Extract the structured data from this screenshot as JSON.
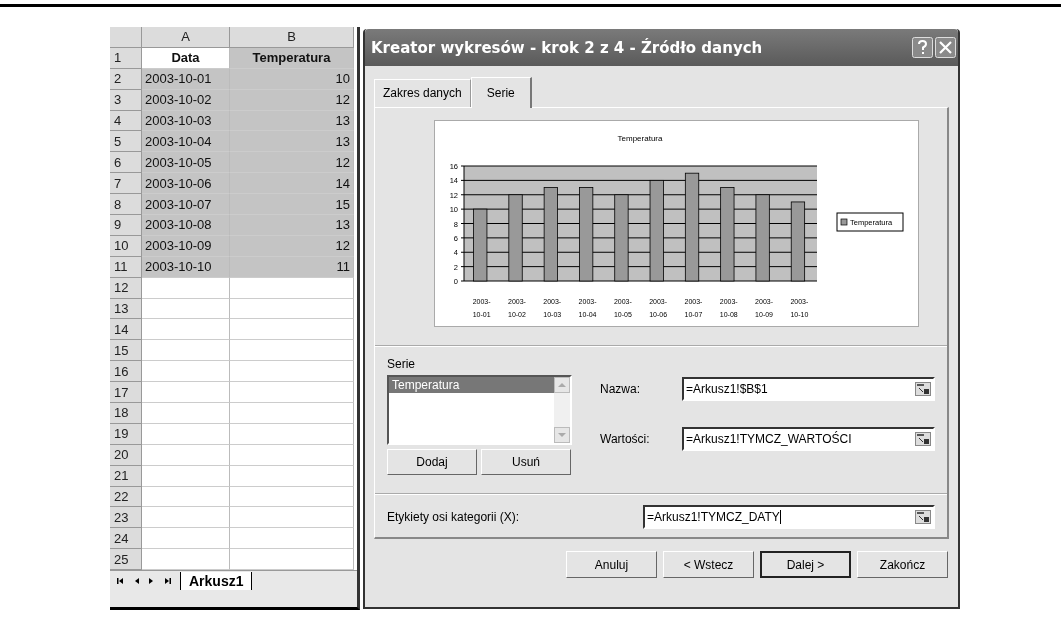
{
  "sheet": {
    "columns": [
      "A",
      "B"
    ],
    "rows": [
      {
        "number": "1",
        "kind": "header",
        "selected": true,
        "cells": [
          "Data",
          "Temperatura"
        ]
      },
      {
        "number": "2",
        "kind": "data",
        "selected": true,
        "cells": [
          "2003-10-01",
          "10"
        ]
      },
      {
        "number": "3",
        "kind": "data",
        "selected": true,
        "cells": [
          "2003-10-02",
          "12"
        ]
      },
      {
        "number": "4",
        "kind": "data",
        "selected": true,
        "cells": [
          "2003-10-03",
          "13"
        ]
      },
      {
        "number": "5",
        "kind": "data",
        "selected": true,
        "cells": [
          "2003-10-04",
          "13"
        ]
      },
      {
        "number": "6",
        "kind": "data",
        "selected": true,
        "cells": [
          "2003-10-05",
          "12"
        ]
      },
      {
        "number": "7",
        "kind": "data",
        "selected": true,
        "cells": [
          "2003-10-06",
          "14"
        ]
      },
      {
        "number": "8",
        "kind": "data",
        "selected": true,
        "cells": [
          "2003-10-07",
          "15"
        ]
      },
      {
        "number": "9",
        "kind": "data",
        "selected": true,
        "cells": [
          "2003-10-08",
          "13"
        ]
      },
      {
        "number": "10",
        "kind": "data",
        "selected": true,
        "cells": [
          "2003-10-09",
          "12"
        ]
      },
      {
        "number": "11",
        "kind": "data",
        "selected": true,
        "cells": [
          "2003-10-10",
          "11"
        ]
      },
      {
        "number": "12"
      },
      {
        "number": "13"
      },
      {
        "number": "14"
      },
      {
        "number": "15"
      },
      {
        "number": "16"
      },
      {
        "number": "17"
      },
      {
        "number": "18"
      },
      {
        "number": "19"
      },
      {
        "number": "20"
      },
      {
        "number": "21"
      },
      {
        "number": "22"
      },
      {
        "number": "23"
      },
      {
        "number": "24"
      },
      {
        "number": "25"
      }
    ],
    "tabs": [
      {
        "label": "Arkusz1",
        "selected": true
      }
    ]
  },
  "dialog": {
    "title": "Kreator wykresów - krok 2 z 4 - Źródło danych",
    "tabs": [
      {
        "label": "Zakres danych",
        "selected": false
      },
      {
        "label": "Serie",
        "selected": true
      }
    ],
    "chart_data": {
      "type": "bar",
      "title": "Temperatura",
      "categories": [
        "2003-10-01",
        "2003-10-02",
        "2003-10-03",
        "2003-10-04",
        "2003-10-05",
        "2003-10-06",
        "2003-10-07",
        "2003-10-08",
        "2003-10-09",
        "2003-10-10"
      ],
      "series": [
        {
          "name": "Temperatura",
          "color": "#999999",
          "values": [
            10,
            12,
            13,
            13,
            12,
            14,
            15,
            13,
            12,
            11
          ]
        }
      ],
      "ylim": [
        0,
        16
      ],
      "grid": true,
      "yticks": [
        0,
        2,
        4,
        6,
        8,
        10,
        12,
        14,
        16
      ]
    },
    "series_label": "Serie",
    "series_list": [
      {
        "label": "Temperatura",
        "selected": true
      }
    ],
    "add_button": "Dodaj",
    "remove_button": "Usuń",
    "fields": [
      {
        "label": "Nazwa:",
        "value": "=Arkusz1!$B$1"
      },
      {
        "label": "Wartości:",
        "value": "=Arkusz1!TYMCZ_WARTOŚCI"
      }
    ],
    "category_field": {
      "label": "Etykiety osi kategorii (X):",
      "value": "=Arkusz1!TYMCZ_DATY"
    },
    "buttons": [
      {
        "label": "Anuluj",
        "default": false
      },
      {
        "label": "< Wstecz",
        "default": false
      },
      {
        "label": "Dalej >",
        "default": true
      },
      {
        "label": "Zakończ",
        "default": false
      }
    ]
  }
}
